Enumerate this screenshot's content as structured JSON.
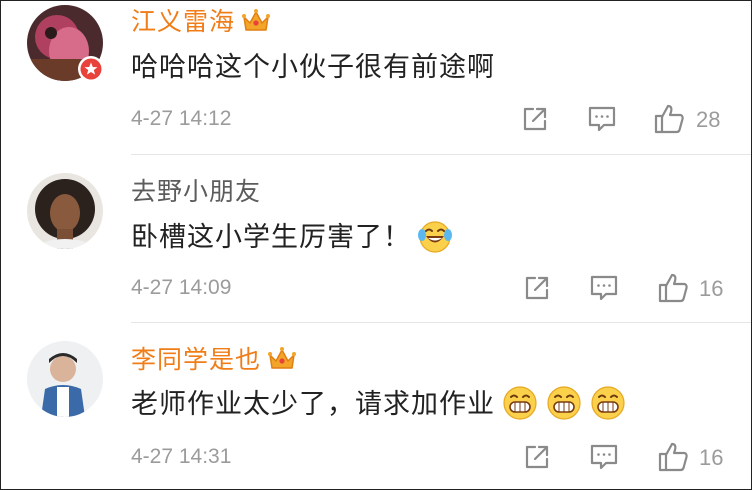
{
  "comments": [
    {
      "username": "江义雷海",
      "text": "哈哈哈这个小伙子很有前途啊",
      "time": "4-27 14:12",
      "likes": "28",
      "vip": true,
      "verified_badge": "red-star-badge",
      "emojis": []
    },
    {
      "username": "去野小朋友",
      "text": "卧槽这小学生厉害了！",
      "time": "4-27 14:09",
      "likes": "16",
      "vip": false,
      "emojis": [
        "laugh-cry-emoji"
      ]
    },
    {
      "username": "李同学是也",
      "text": "老师作业太少了，请求加作业",
      "time": "4-27 14:31",
      "likes": "16",
      "vip": true,
      "emojis": [
        "grin-emoji",
        "grin-emoji",
        "grin-emoji"
      ]
    }
  ],
  "icons": {
    "forward": "share-forward-icon",
    "reply": "comment-reply-icon",
    "like": "thumbs-up-icon",
    "vip": "crown-icon"
  },
  "colors": {
    "vip_name": "#f07d18",
    "normal_name": "#5c5c5c",
    "meta": "#9b9b9b",
    "crown": "#f3a52a"
  }
}
